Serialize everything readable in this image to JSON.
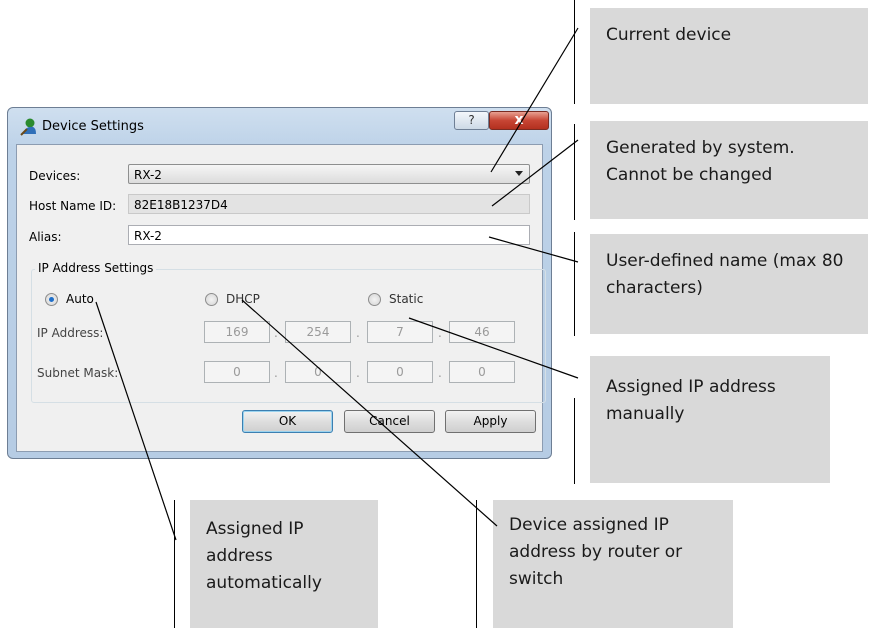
{
  "dialog": {
    "title": "Device Settings",
    "help_label": "?",
    "close_label": "x",
    "devices_label": "Devices:",
    "devices_value": "RX-2",
    "host_label": "Host Name ID:",
    "host_value": "82E18B1237D4",
    "alias_label": "Alias:",
    "alias_value": "RX-2",
    "ip_group_title": "IP Address Settings",
    "radio_auto": "Auto",
    "radio_dhcp": "DHCP",
    "radio_static": "Static",
    "selected_mode": "Auto",
    "ip_label": "IP Address:",
    "ip_octets": [
      "169",
      "254",
      "7",
      "46"
    ],
    "mask_label": "Subnet Mask:",
    "mask_octets": [
      "0",
      "0",
      "0",
      "0"
    ],
    "ok_label": "OK",
    "cancel_label": "Cancel",
    "apply_label": "Apply"
  },
  "callouts": {
    "current_device": "Current device",
    "generated": "Generated by system. Cannot be changed",
    "user_defined": "User-defined name (max 80 characters)",
    "assigned_manual": "Assigned IP address manually",
    "assigned_auto": "Assigned IP address automatically",
    "device_router": "Device assigned IP address by router or switch"
  },
  "colors": {
    "callout_bg": "#d9d9d9",
    "dialog_frame": "#bdd2e8",
    "radio_selected": "#1f6fc9"
  }
}
